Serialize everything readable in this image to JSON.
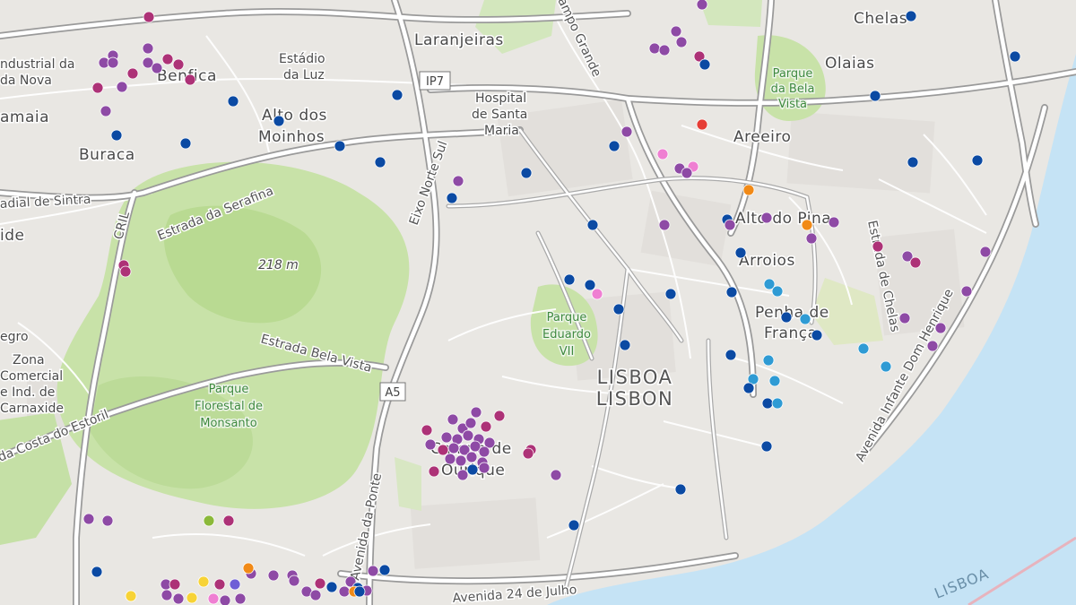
{
  "map": {
    "city_label": "LISBOA",
    "city_label_en": "LISBON",
    "places": [
      {
        "id": "chelas",
        "text": "Chelas"
      },
      {
        "id": "laranjeiras",
        "text": "Laranjeiras"
      },
      {
        "id": "olaias",
        "text": "Olaias"
      },
      {
        "id": "estadio-luz-1",
        "text": "Estádio"
      },
      {
        "id": "estadio-luz-2",
        "text": "da Luz"
      },
      {
        "id": "benfica",
        "text": "Benfica"
      },
      {
        "id": "industrial-1",
        "text": "ndustrial da"
      },
      {
        "id": "industrial-2",
        "text": "da Nova"
      },
      {
        "id": "amaia",
        "text": "amaia"
      },
      {
        "id": "alto-moinhos-1",
        "text": "Alto dos"
      },
      {
        "id": "alto-moinhos-2",
        "text": "Moinhos"
      },
      {
        "id": "buraca",
        "text": "Buraca"
      },
      {
        "id": "areeiro",
        "text": "Areeiro"
      },
      {
        "id": "alto-pina",
        "text": "Alto do Pina"
      },
      {
        "id": "arroios",
        "text": "Arroios"
      },
      {
        "id": "penha-1",
        "text": "Penha de"
      },
      {
        "id": "penha-2",
        "text": "França"
      },
      {
        "id": "campo-ourique-1",
        "text": "Campo de"
      },
      {
        "id": "campo-ourique-2",
        "text": "Ourique"
      },
      {
        "id": "zona-1",
        "text": "Zona"
      },
      {
        "id": "zona-2",
        "text": "Comercial"
      },
      {
        "id": "zona-3",
        "text": "e Ind. de"
      },
      {
        "id": "zona-4",
        "text": "Carnaxide"
      },
      {
        "id": "negro",
        "text": "egro"
      },
      {
        "id": "ide",
        "text": "ide"
      },
      {
        "id": "hospital-1",
        "text": "Hospital"
      },
      {
        "id": "hospital-2",
        "text": "de Santa"
      },
      {
        "id": "hospital-3",
        "text": "Maria"
      },
      {
        "id": "lisboa-water",
        "text": "LISBOA"
      }
    ],
    "parks": [
      {
        "id": "parque-bela-vista-1",
        "text": "Parque"
      },
      {
        "id": "parque-bela-vista-2",
        "text": "da Bela"
      },
      {
        "id": "parque-bela-vista-3",
        "text": "Vista"
      },
      {
        "id": "parque-eduardo-1",
        "text": "Parque"
      },
      {
        "id": "parque-eduardo-2",
        "text": "Eduardo"
      },
      {
        "id": "parque-eduardo-3",
        "text": "VII"
      },
      {
        "id": "monsanto-1",
        "text": "Parque"
      },
      {
        "id": "monsanto-2",
        "text": "Florestal de"
      },
      {
        "id": "monsanto-3",
        "text": "Monsanto"
      }
    ],
    "roads": [
      {
        "id": "radial-sintra",
        "text": "adial de Sintra"
      },
      {
        "id": "estrada-serafina",
        "text": "Estrada da Serafina"
      },
      {
        "id": "estrada-bela-vista",
        "text": "Estrada Bela Vista"
      },
      {
        "id": "costa-estoril",
        "text": "da Costa do Estoril"
      },
      {
        "id": "avenida-ponte",
        "text": "Avenida da Ponte"
      },
      {
        "id": "avenida-24-julho",
        "text": "Avenida 24 de Julho"
      },
      {
        "id": "eixo-norte-sul",
        "text": "Eixo Norte Sul"
      },
      {
        "id": "campo-grande",
        "text": "ampo Grande"
      },
      {
        "id": "avenida-infante",
        "text": "Avenida Infante Dom Henrique"
      },
      {
        "id": "estrada-chelas",
        "text": "Estrada de Chelas"
      },
      {
        "id": "cril",
        "text": "CRIL"
      }
    ],
    "shields": [
      {
        "id": "ip7",
        "text": "IP7"
      },
      {
        "id": "a5",
        "text": "A5"
      }
    ],
    "spot_height": "218 m",
    "marker_colors": {
      "navy": "#0b4aa3",
      "purple": "#8e4aa5",
      "magenta": "#ad3277",
      "pink": "#ef7fd2",
      "cyan": "#2f9bd4",
      "orange": "#f18a17",
      "red": "#e63e36",
      "yellow": "#f7d336",
      "green": "#8bb93a",
      "violet": "#6f5fd6"
    }
  }
}
